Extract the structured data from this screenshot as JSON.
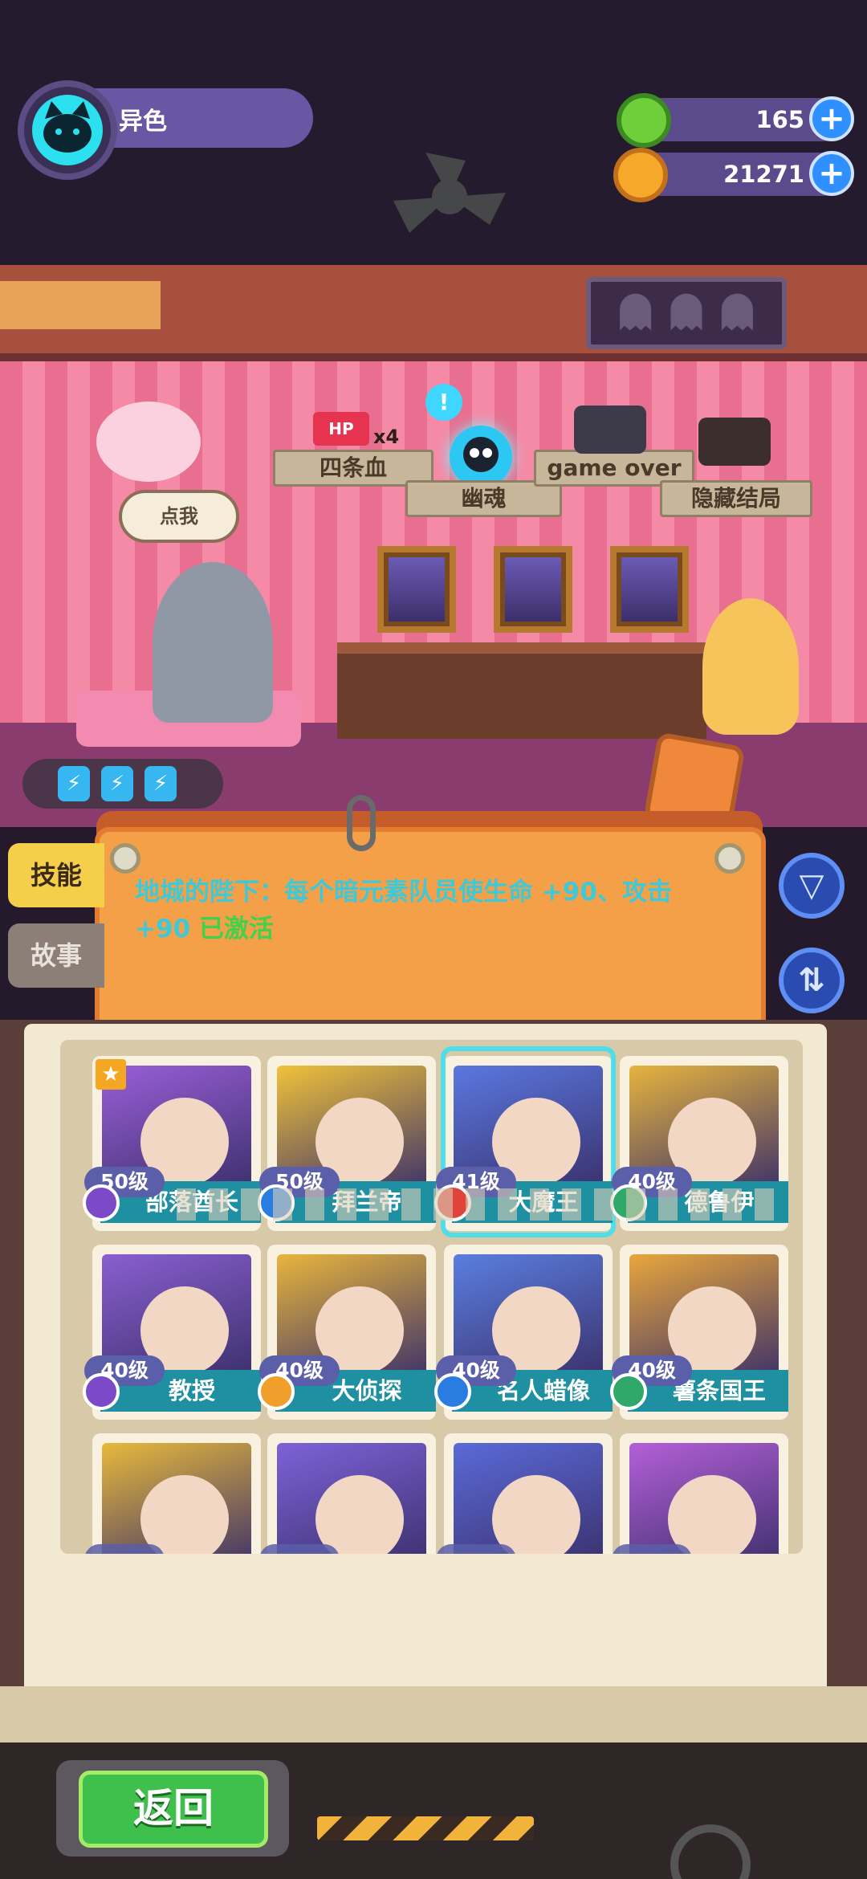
{
  "profile": {
    "name": "异色"
  },
  "currency": {
    "gems": {
      "value": "165",
      "plus": "+"
    },
    "coins": {
      "value": "21271",
      "plus": "+"
    }
  },
  "room": {
    "speech_bubble": "点我",
    "hp_badge": "HP",
    "hp_multiplier": "x4",
    "alert": "!",
    "endings": [
      "四条血",
      "幽魂",
      "game over",
      "隐藏结局"
    ],
    "energy_icons": [
      "⚡",
      "⚡",
      "⚡"
    ]
  },
  "tabs": {
    "skill": "技能",
    "story": "故事"
  },
  "skill": {
    "text": "地城的陛下：每个暗元素队员使生命 +90、攻击 +90",
    "status": "已激活"
  },
  "side_buttons": {
    "filter_icon": "▽",
    "sort_icon": "⇅"
  },
  "colors": {
    "skill_text": "#3ec9d9",
    "active_text": "#43d04a",
    "name_bar": "#1f8fa2",
    "level_pill": "#5b5ea8",
    "return_button": "#3fbf4b"
  },
  "cards": [
    {
      "level": "50级",
      "name": "部落酋长",
      "class_color": "#7c4ac8",
      "art": "#9a5fd8",
      "starred": true
    },
    {
      "level": "50级",
      "name": "拜兰帝",
      "class_color": "#2a7de0",
      "art": "#f0c23a"
    },
    {
      "level": "41级",
      "name": "大魔王",
      "class_color": "#e0433a",
      "art": "#5a78e0",
      "selected": true
    },
    {
      "level": "40级",
      "name": "德鲁伊",
      "class_color": "#2fa86a",
      "art": "#e6b43e"
    },
    {
      "level": "40级",
      "name": "教授",
      "class_color": "#7c4ac8",
      "art": "#8a5fd0"
    },
    {
      "level": "40级",
      "name": "大侦探",
      "class_color": "#f0a02a",
      "art": "#e8b53c"
    },
    {
      "level": "40级",
      "name": "名人蜡像",
      "class_color": "#2a7de0",
      "art": "#5a7ee0"
    },
    {
      "level": "40级",
      "name": "薯条国王",
      "class_color": "#2fa86a",
      "art": "#e8a63c"
    },
    {
      "level": "",
      "name": "",
      "class_color": "#7c4ac8",
      "art": "#e8b93c"
    },
    {
      "level": "",
      "name": "",
      "class_color": "#2a7de0",
      "art": "#7d62d8"
    },
    {
      "level": "",
      "name": "",
      "class_color": "#e0433a",
      "art": "#5a6ad8"
    },
    {
      "level": "",
      "name": "",
      "class_color": "#2fa86a",
      "art": "#b45fd8"
    }
  ],
  "bottom": {
    "return_label": "返回"
  }
}
